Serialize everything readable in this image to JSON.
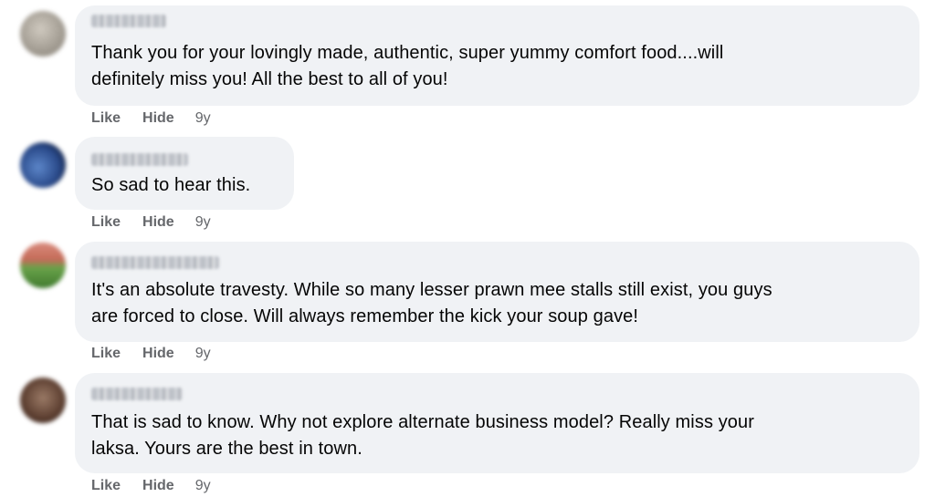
{
  "comments": [
    {
      "text": "Thank you for your lovingly made, authentic, super yummy comfort food....will\ndefinitely miss you! All the best to all of you!",
      "avatar_colors": [
        "#b9b3a8",
        "#8f8a80"
      ],
      "actions": {
        "like": "Like",
        "hide": "Hide",
        "time": "9y"
      }
    },
    {
      "text": "So sad to hear this.",
      "avatar_colors": [
        "#5c86c9",
        "#1c2f5e"
      ],
      "actions": {
        "like": "Like",
        "hide": "Hide",
        "time": "9y"
      }
    },
    {
      "text": "It's an absolute travesty. While so many lesser prawn mee stalls still exist, you guys\nare forced to close. Will always remember the kick your soup gave!",
      "avatar_colors": [
        "#d37a6a",
        "#4f8e3c"
      ],
      "actions": {
        "like": "Like",
        "hide": "Hide",
        "time": "9y"
      }
    },
    {
      "text": "That is sad to know. Why not explore alternate business model? Really miss your\nlaksa. Yours are the best in town.",
      "avatar_colors": [
        "#7a5a48",
        "#3e2a20"
      ],
      "actions": {
        "like": "Like",
        "hide": "Hide",
        "time": "9y"
      }
    }
  ]
}
